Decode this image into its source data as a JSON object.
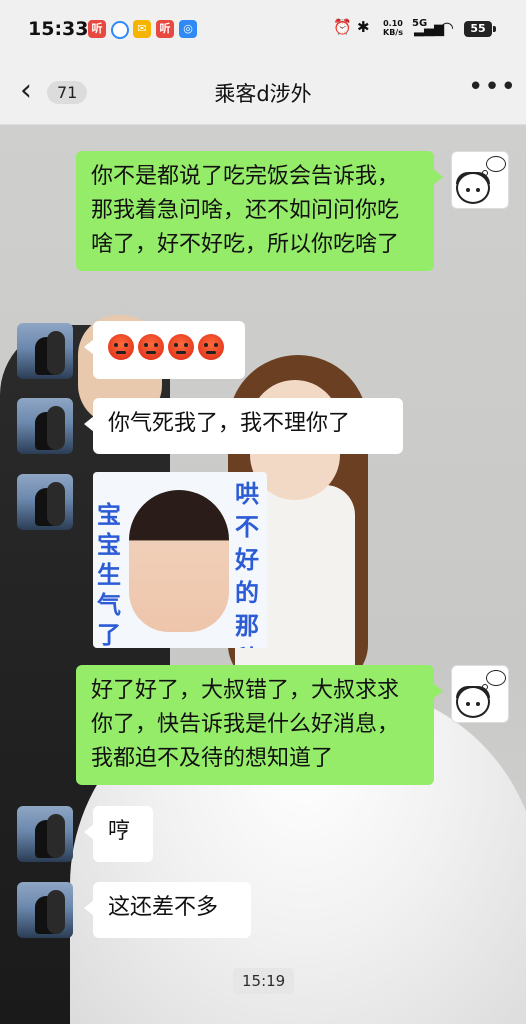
{
  "status_bar": {
    "time": "15:33",
    "net_speed_value": "0.10",
    "net_speed_unit": "KB/s",
    "signal": "5G",
    "battery": "55",
    "app_icons": [
      "notif-app-1",
      "notif-app-2",
      "notif-app-3",
      "notif-app-4",
      "notif-app-5"
    ],
    "colors": {
      "red": "#e8483f",
      "blue": "#2f8af5",
      "yellow": "#f4b400"
    }
  },
  "nav": {
    "back_icon": "chevron-left-icon",
    "unread_count": "71",
    "title": "乘客d涉外",
    "more_icon": "more-dots-icon"
  },
  "messages": [
    {
      "side": "right",
      "type": "text",
      "text": "你不是都说了吃完饭会告诉我，那我着急问啥，还不如问问你吃啥了，好不好吃，所以你吃啥了"
    },
    {
      "side": "left",
      "type": "emoji",
      "emoji": [
        "angry-face-icon",
        "angry-face-icon",
        "angry-face-icon",
        "angry-face-icon"
      ]
    },
    {
      "side": "left",
      "type": "text",
      "text": "你气死我了，我不理你了"
    },
    {
      "side": "left",
      "type": "sticker",
      "caption_left": "宝宝生气了",
      "caption_right": "哄不好的那种"
    },
    {
      "side": "right",
      "type": "text",
      "text": "好了好了，大叔错了，大叔求求你了，快告诉我是什么好消息，我都迫不及待的想知道了"
    },
    {
      "side": "left",
      "type": "text",
      "text": "哼"
    },
    {
      "side": "left",
      "type": "text",
      "text": "这还差不多"
    }
  ],
  "timestamp": "15:19",
  "colors": {
    "green_bubble": "#95ec69",
    "white_bubble": "#ffffff",
    "accent_blue": "#2b5cd6"
  }
}
